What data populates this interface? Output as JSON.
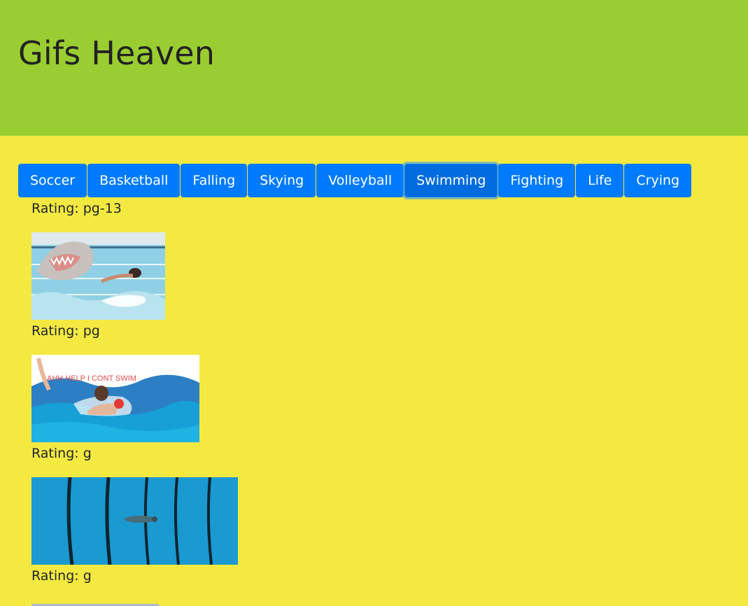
{
  "header": {
    "title": "Gifs Heaven"
  },
  "topics": [
    {
      "label": "Soccer"
    },
    {
      "label": "Basketball"
    },
    {
      "label": "Falling"
    },
    {
      "label": "Skying"
    },
    {
      "label": "Volleyball"
    },
    {
      "label": "Swimming",
      "active": true
    },
    {
      "label": "Fighting"
    },
    {
      "label": "Life"
    },
    {
      "label": "Crying"
    }
  ],
  "gifs": [
    {
      "rating": "Rating: pg-13"
    },
    {
      "rating": "Rating: pg",
      "caption_text": "AHH HELP I CONT SWIM"
    },
    {
      "rating": "Rating: g"
    },
    {
      "rating": "Rating: g"
    }
  ],
  "colors": {
    "header_bg": "#9acd32",
    "page_bg": "#f3e941",
    "button_bg": "#007bff",
    "button_text": "#ffffff"
  }
}
